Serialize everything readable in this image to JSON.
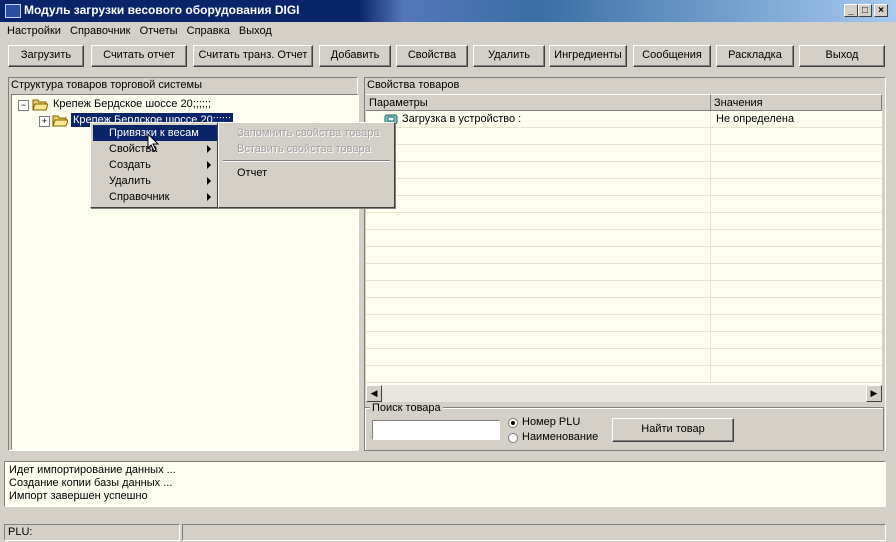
{
  "window": {
    "title": "Модуль загрузки весового оборудования DIGI"
  },
  "menu": [
    "Настройки",
    "Справочник",
    "Отчеты",
    "Справка",
    "Выход"
  ],
  "toolbar": [
    "Загрузить",
    "Считать отчет",
    "Считать транз. Отчет",
    "Добавить",
    "Свойства",
    "Удалить",
    "Ингредиенты",
    "Сообщения",
    "Раскладка",
    "Выход"
  ],
  "left_panel": {
    "title": "Структура товаров торговой системы",
    "tree": {
      "root": "Крепеж Бердское шоссе 20;;;;;;",
      "child": "Крепеж Бердское шоссе 20;;;;;;"
    }
  },
  "context_menu": {
    "items": [
      "Привязки к весам",
      "Свойства",
      "Создать",
      "Удалить",
      "Справочник"
    ],
    "submenu": {
      "disabled": [
        "Запомнить свойства товара",
        "Вставить свойства товара"
      ],
      "enabled": [
        "Отчет"
      ]
    }
  },
  "right_panel": {
    "title": "Свойства товаров",
    "columns": [
      "Параметры",
      "Значения"
    ],
    "rows": [
      {
        "param": "Загрузка в устройство :",
        "value": "Не определена"
      }
    ]
  },
  "search": {
    "title": "Поиск товара",
    "input_value": "",
    "radio_plu": "Номер PLU",
    "radio_name": "Наименование",
    "selected": "plu",
    "button": "Найти товар"
  },
  "log": [
    "Идет импортирование данных ...",
    "Создание копии базы данных ...",
    "Импорт завершен успешно"
  ],
  "status": {
    "plu_label": "PLU:",
    "right": ""
  }
}
